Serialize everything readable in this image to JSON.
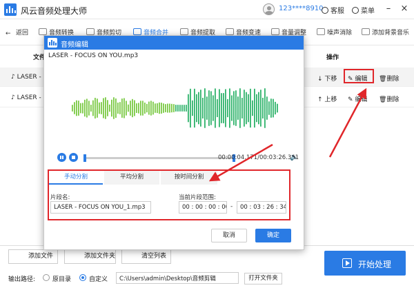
{
  "app": {
    "title": "风云音频处理大师",
    "user": "123****8910",
    "service": "客服",
    "menu": "菜单"
  },
  "toolbar": {
    "items": [
      {
        "label": "返回",
        "icon": "back-arrow-icon"
      },
      {
        "label": "音频转换",
        "icon": "convert-icon"
      },
      {
        "label": "音频剪切",
        "icon": "scissors-icon"
      },
      {
        "label": "音频合并",
        "icon": "merge-icon"
      },
      {
        "label": "音频提取",
        "icon": "extract-icon"
      },
      {
        "label": "音频变速",
        "icon": "speed-icon"
      },
      {
        "label": "音量调整",
        "icon": "volume-icon"
      },
      {
        "label": "噪声消除",
        "icon": "noise-icon"
      },
      {
        "label": "添加背景音乐",
        "icon": "music-icon"
      }
    ]
  },
  "list": {
    "col_file": "文件",
    "col_op": "操作",
    "rows": [
      {
        "name": "LASER - FOCUS ON YOU.mp3",
        "move": "下移",
        "edit": "编辑",
        "delete": "删除"
      },
      {
        "name": "LASER - LA",
        "move": "上移",
        "edit": "编辑",
        "delete": "删除"
      }
    ]
  },
  "bottom": {
    "add_file": "添加文件",
    "add_folder": "添加文件夹",
    "clear": "清空列表",
    "output_label": "输出路径:",
    "opt_original": "原目录",
    "opt_custom": "自定义",
    "path": "C:\\Users\\admin\\Desktop\\音频剪辑",
    "open_folder": "打开文件夹",
    "start": "开始处理"
  },
  "dialog": {
    "title": "音频编辑",
    "file": "LASER - FOCUS ON YOU.mp3",
    "time": "00:00:04.171/00:03:26.341",
    "tabs": [
      "手动分割",
      "平均分割",
      "按时间分割"
    ],
    "segment_label": "片段名:",
    "segment_value": "LASER - FOCUS ON YOU_1.mp3",
    "range_label": "当前片段范围:",
    "range_start": "00 : 00 : 00 : 000",
    "range_sep": "-",
    "range_end": "00 : 03 : 26 : 341",
    "cancel": "取消",
    "ok": "确定"
  },
  "colors": {
    "accent": "#2a7be4",
    "annotation": "#e0262a",
    "wave_start": "#7ac943",
    "wave_end": "#2fb36b"
  }
}
